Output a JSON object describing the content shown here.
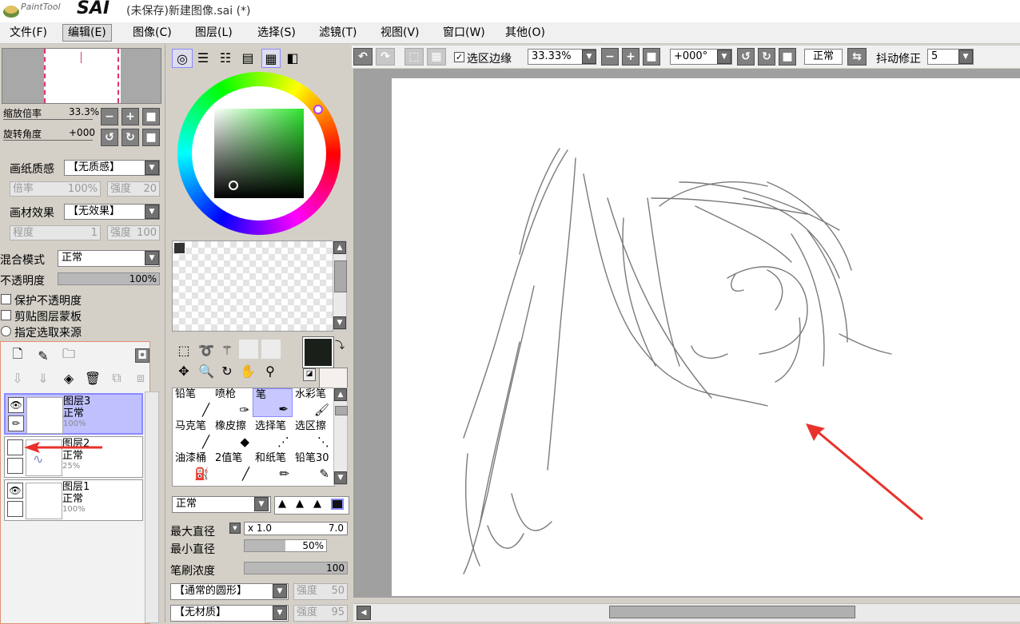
{
  "window": {
    "title": "(未保存)新建图像.sai (*)",
    "logo_small": "PaintTool",
    "logo_big": "SAI"
  },
  "menu": [
    "文件(F)",
    "编辑(E)",
    "图像(C)",
    "图层(L)",
    "选择(S)",
    "滤镜(T)",
    "视图(V)",
    "窗口(W)",
    "其他(O)"
  ],
  "navigator": {
    "zoom_label": "缩放倍率",
    "zoom_value": "33.3%",
    "rotate_label": "旋转角度",
    "rotate_value": "+000"
  },
  "paper_texture": {
    "label": "画纸质感",
    "value": "【无质感】",
    "scale_label": "倍率",
    "scale_value": "100%",
    "strength_label": "强度",
    "strength_value": "20"
  },
  "material_effect": {
    "label": "画材效果",
    "value": "【无效果】",
    "degree_label": "程度",
    "degree_value": "1",
    "strength_label": "强度",
    "strength_value": "100"
  },
  "blend": {
    "label": "混合模式",
    "value": "正常",
    "opacity_label": "不透明度",
    "opacity_value": "100%",
    "opacity": 1.0
  },
  "options": {
    "protect_opacity": "保护不透明度",
    "clip_mask": "剪贴图层蒙板",
    "select_source": "指定选取来源"
  },
  "layers": [
    {
      "name": "图层3",
      "mode": "正常",
      "opacity": "100%",
      "selected": true
    },
    {
      "name": "图层2",
      "mode": "正常",
      "opacity": "25%",
      "selected": false
    },
    {
      "name": "图层1",
      "mode": "正常",
      "opacity": "100%",
      "selected": false
    }
  ],
  "tools": [
    [
      "铅笔",
      "喷枪",
      "笔",
      "水彩笔"
    ],
    [
      "马克笔",
      "橡皮擦",
      "选择笔",
      "选区擦"
    ],
    [
      "油漆桶",
      "2值笔",
      "和纸笔",
      "铅笔30"
    ]
  ],
  "brush": {
    "mode": "正常",
    "max_diameter_label": "最大直径",
    "max_mult": "x 1.0",
    "max_value": "7.0",
    "min_diameter_label": "最小直径",
    "min_value": "50%",
    "min_fraction": 0.5,
    "density_label": "笔刷浓度",
    "density_value": "100",
    "density_fraction": 1.0,
    "shape": "【通常的圆形】",
    "shape_strength_label": "强度",
    "shape_strength": "50",
    "texture": "【无材质】",
    "texture_strength_label": "强度",
    "texture_strength": "95"
  },
  "toolbar": {
    "selection_edge_label": "选区边缘",
    "zoom": "33.33%",
    "angle": "+000°",
    "mode": "正常",
    "stabilizer_label": "抖动修正",
    "stabilizer_value": "5"
  },
  "colors": {
    "primary": "#1a1f1a",
    "secondary": "#f4f0ee",
    "accent": "#8a8aff",
    "arrow": "#e8322a"
  }
}
